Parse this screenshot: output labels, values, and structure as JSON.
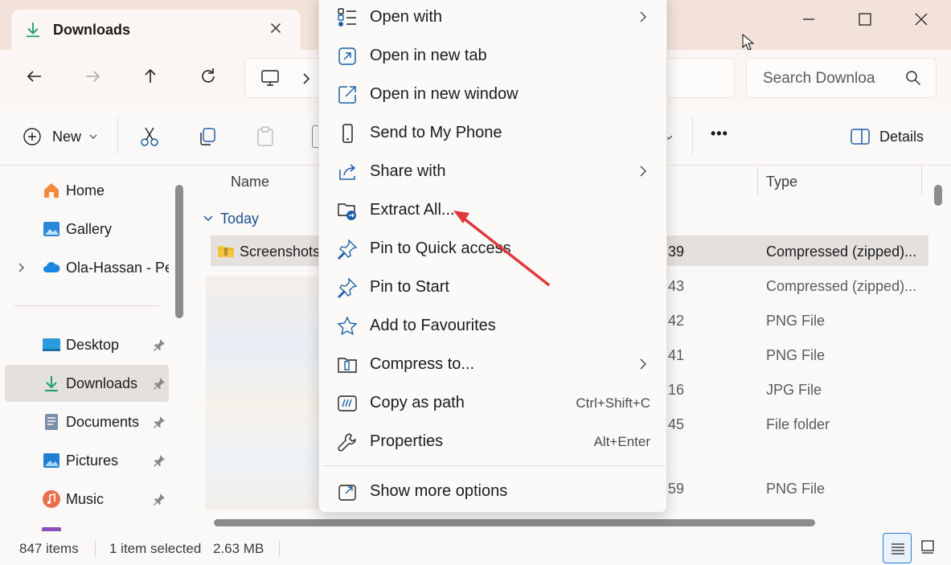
{
  "window": {
    "tab_title": "Downloads",
    "search_placeholder": "Search Downloa"
  },
  "toolbar": {
    "new_label": "New",
    "details_label": "Details",
    "more_label": "•••"
  },
  "nav": {
    "items": [
      {
        "label": "Home",
        "icon": "home-icon"
      },
      {
        "label": "Gallery",
        "icon": "gallery-icon"
      },
      {
        "label": "Ola-Hassan - Per",
        "icon": "onedrive-cloud-icon"
      },
      {
        "label": "Desktop",
        "icon": "desktop-folder-icon"
      },
      {
        "label": "Downloads",
        "icon": "downloads-folder-icon"
      },
      {
        "label": "Documents",
        "icon": "documents-folder-icon"
      },
      {
        "label": "Pictures",
        "icon": "pictures-folder-icon"
      },
      {
        "label": "Music",
        "icon": "music-folder-icon"
      }
    ]
  },
  "content": {
    "columns": {
      "name": "Name",
      "type": "Type"
    },
    "group_label": "Today",
    "rows": [
      {
        "name": "Screenshots",
        "date": "39",
        "type": "Compressed (zipped)..."
      },
      {
        "name": "",
        "date": "43",
        "type": "Compressed (zipped)..."
      },
      {
        "name": "",
        "date": "42",
        "type": "PNG File"
      },
      {
        "name": "",
        "date": "41",
        "type": "PNG File"
      },
      {
        "name": "",
        "date": "16",
        "type": "JPG File"
      },
      {
        "name": "",
        "date": "45",
        "type": "File folder"
      },
      {
        "name": "",
        "date": "59",
        "type": "PNG File"
      }
    ]
  },
  "status": {
    "item_count": "847 items",
    "selection": "1 item selected",
    "size": "2.63 MB"
  },
  "context_menu": {
    "items": [
      {
        "label": "Open with",
        "icon": "open-with-icon",
        "submenu": true
      },
      {
        "label": "Open in new tab",
        "icon": "new-tab-icon"
      },
      {
        "label": "Open in new window",
        "icon": "new-window-icon"
      },
      {
        "label": "Send to My Phone",
        "icon": "phone-icon"
      },
      {
        "label": "Share with",
        "icon": "share-icon",
        "submenu": true
      },
      {
        "label": "Extract All...",
        "icon": "extract-icon"
      },
      {
        "label": "Pin to Quick access",
        "icon": "pin-icon"
      },
      {
        "label": "Pin to Start",
        "icon": "pin-start-icon"
      },
      {
        "label": "Add to Favourites",
        "icon": "star-icon"
      },
      {
        "label": "Compress to...",
        "icon": "compress-icon",
        "submenu": true
      },
      {
        "label": "Copy as path",
        "icon": "copy-path-icon",
        "shortcut": "Ctrl+Shift+C"
      },
      {
        "label": "Properties",
        "icon": "wrench-icon",
        "shortcut": "Alt+Enter"
      },
      {
        "label": "Show more options",
        "icon": "more-options-icon"
      }
    ]
  },
  "colors": {
    "accent": "#0f6cbd",
    "annotation_arrow": "#e0393b",
    "download_green": "#1e9e6b"
  }
}
